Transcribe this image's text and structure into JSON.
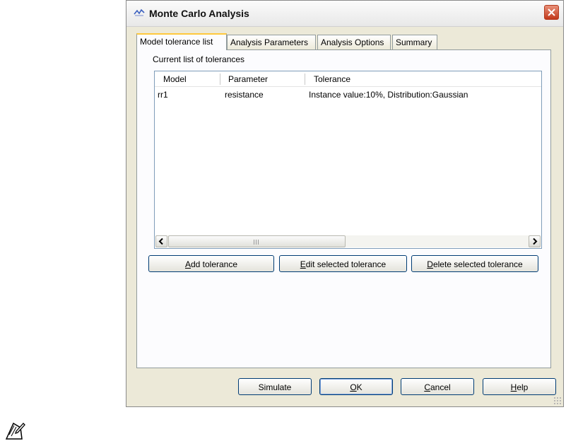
{
  "window": {
    "title": "Monte Carlo Analysis"
  },
  "tabs": [
    {
      "label": "Model tolerance list",
      "active": true
    },
    {
      "label": "Analysis Parameters",
      "active": false
    },
    {
      "label": "Analysis Options",
      "active": false
    },
    {
      "label": "Summary",
      "active": false
    }
  ],
  "tolerance_section": {
    "label": "Current list of tolerances",
    "columns": [
      "Model",
      "Parameter",
      "Tolerance"
    ],
    "rows": [
      {
        "model": "rr1",
        "parameter": "resistance",
        "tolerance": "Instance value:10%, Distribution:Gaussian"
      }
    ]
  },
  "list_actions": {
    "add": {
      "underline": "A",
      "rest": "dd tolerance"
    },
    "edit": {
      "underline": "E",
      "rest": "dit selected tolerance"
    },
    "delete": {
      "underline": "D",
      "rest": "elete selected tolerance"
    }
  },
  "footer": {
    "simulate": "Simulate",
    "ok": {
      "underline": "O",
      "rest": "K"
    },
    "cancel": {
      "underline": "C",
      "rest": "ancel"
    },
    "help": {
      "underline": "H",
      "rest": "elp"
    }
  },
  "icons": {
    "app": "simulation-app-icon",
    "close": "close-icon",
    "scroll_left": "chevron-left-icon",
    "scroll_right": "chevron-right-icon",
    "note": "note-pencil-icon"
  },
  "colors": {
    "dialog_bg": "#ece9d8",
    "close_button": "#c2381a",
    "active_tab_accent": "#ffc83c",
    "button_border": "#003c74"
  }
}
